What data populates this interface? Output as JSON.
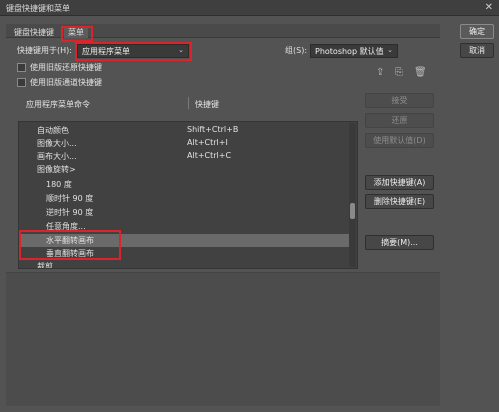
{
  "window": {
    "title": "键盘快捷键和菜单",
    "close_glyph": "✕"
  },
  "tabs": [
    {
      "label": "键盘快捷键"
    },
    {
      "label": "菜单"
    }
  ],
  "shortcuts_for": {
    "label": "快捷键用于(H):",
    "value": "应用程序菜单"
  },
  "set": {
    "label": "组(S):",
    "value": "Photoshop 默认值"
  },
  "checkboxes": [
    {
      "label": "使用旧版还原快捷键",
      "checked": false
    },
    {
      "label": "使用旧版通道快捷键",
      "checked": false
    }
  ],
  "icons": {
    "save_set": "save-set-icon",
    "new_set": "new-set-icon",
    "delete_set": "delete-set-icon"
  },
  "columns": {
    "command": "应用程序菜单命令",
    "shortcut": "快捷键"
  },
  "rows": [
    {
      "command": "自动颜色",
      "shortcut": "Shift+Ctrl+B",
      "indent": 1,
      "selected": false
    },
    {
      "command": "图像大小...",
      "shortcut": "Alt+Ctrl+I",
      "indent": 1,
      "selected": false
    },
    {
      "command": "画布大小...",
      "shortcut": "Alt+Ctrl+C",
      "indent": 1,
      "selected": false
    },
    {
      "command": "图像旋转>",
      "shortcut": "",
      "indent": 1,
      "selected": false
    },
    {
      "command": "180 度",
      "shortcut": "",
      "indent": 2,
      "selected": false
    },
    {
      "command": "顺时针 90 度",
      "shortcut": "",
      "indent": 2,
      "selected": false
    },
    {
      "command": "逆时针 90 度",
      "shortcut": "",
      "indent": 2,
      "selected": false
    },
    {
      "command": "任意角度...",
      "shortcut": "",
      "indent": 2,
      "selected": false
    },
    {
      "command": "水平翻转画布",
      "shortcut": "",
      "indent": 2,
      "selected": true
    },
    {
      "command": "垂直翻转画布",
      "shortcut": "",
      "indent": 2,
      "selected": false
    },
    {
      "command": "裁剪",
      "shortcut": "",
      "indent": 0,
      "selected": false
    }
  ],
  "right_buttons": {
    "accept": "接受",
    "undo": "还原",
    "use_default": "使用默认值(D)",
    "add_shortcut": "添加快捷键(A)",
    "delete_shortcut": "删除快捷键(E)",
    "summarize": "摘要(M)..."
  },
  "dialog_buttons": {
    "ok": "确定",
    "cancel": "取消"
  },
  "colors": {
    "highlight_border": "#d8242a",
    "background": "#535353"
  }
}
